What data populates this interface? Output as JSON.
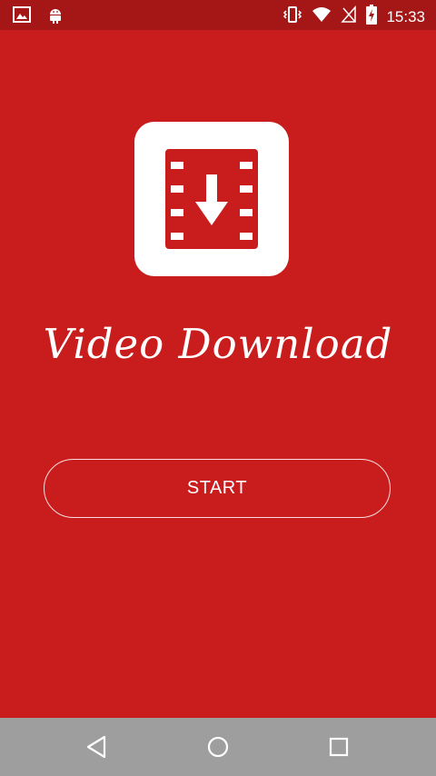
{
  "statusbar": {
    "time": "15:33",
    "left_icons": [
      "image-icon",
      "android-icon"
    ],
    "right_icons": [
      "vibrate-icon",
      "wifi-icon",
      "no-sim-icon",
      "battery-charging-icon"
    ],
    "bg_color": "#a51616"
  },
  "app": {
    "title": "Video Download",
    "start_label": "START",
    "icon": "video-download-icon",
    "bg_color": "#c91d1d"
  },
  "navbar": {
    "buttons": [
      "back-icon",
      "home-icon",
      "recents-icon"
    ],
    "bg_color": "#9e9e9e"
  }
}
